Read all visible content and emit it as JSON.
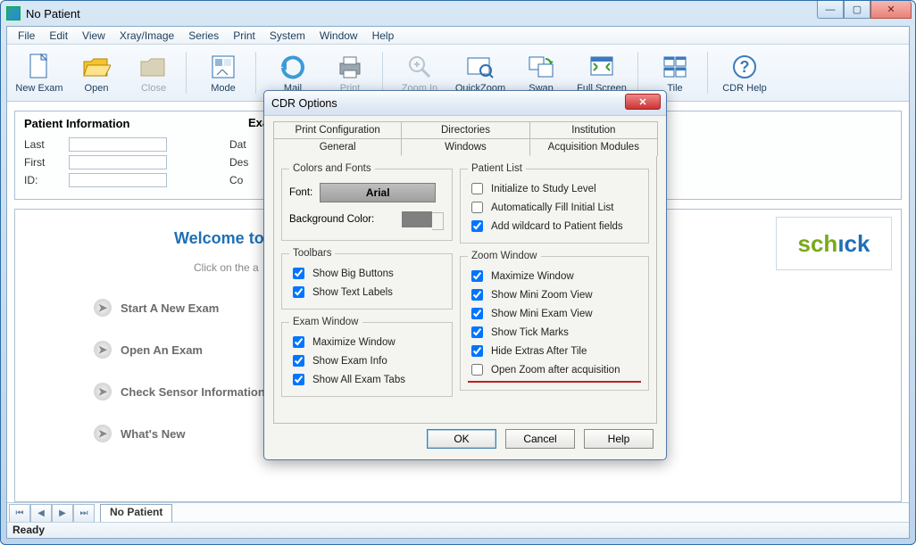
{
  "window": {
    "title": "No Patient"
  },
  "menu": [
    "File",
    "Edit",
    "View",
    "Xray/Image",
    "Series",
    "Print",
    "System",
    "Window",
    "Help"
  ],
  "toolbar": [
    {
      "label": "New Exam",
      "disabled": false,
      "icon": "new"
    },
    {
      "label": "Open",
      "disabled": false,
      "icon": "open"
    },
    {
      "label": "Close",
      "disabled": true,
      "icon": "close"
    },
    {
      "sep": true
    },
    {
      "label": "Mode",
      "disabled": false,
      "icon": "mode"
    },
    {
      "sep": true
    },
    {
      "label": "Mail",
      "disabled": false,
      "icon": "mail"
    },
    {
      "label": "Print",
      "disabled": true,
      "icon": "print"
    },
    {
      "sep": true
    },
    {
      "label": "Zoom In",
      "disabled": true,
      "icon": "zoomin"
    },
    {
      "label": "QuickZoom",
      "disabled": false,
      "icon": "quickzoom"
    },
    {
      "label": "Swap",
      "disabled": false,
      "icon": "swap"
    },
    {
      "label": "Full Screen",
      "disabled": false,
      "icon": "fullscreen"
    },
    {
      "sep": true
    },
    {
      "label": "Tile",
      "disabled": false,
      "icon": "tile"
    },
    {
      "sep": true
    },
    {
      "label": "CDR Help",
      "disabled": false,
      "icon": "help"
    }
  ],
  "patient_panel": {
    "heading": "Patient Information",
    "heading2": "Exa",
    "rows": [
      {
        "label": "Last",
        "label2": "Dat"
      },
      {
        "label": "First",
        "label2": "Des"
      },
      {
        "label": "ID:",
        "label2": "Co"
      }
    ]
  },
  "welcome": {
    "title": "Welcome to",
    "sub": "Click on the a",
    "items": [
      "Start A New Exam",
      "Open An Exam",
      "Check Sensor Information",
      "What's New"
    ],
    "logo": {
      "part1": "sch",
      "part2": "ıck"
    }
  },
  "tab": "No Patient",
  "status": "Ready",
  "dialog": {
    "title": "CDR Options",
    "tabs_row1": [
      "Print Configuration",
      "Directories",
      "Institution"
    ],
    "tabs_row2": [
      "General",
      "Windows",
      "Acquisition Modules"
    ],
    "active_tab": "Windows",
    "colors_fonts": {
      "legend": "Colors and Fonts",
      "font_label": "Font:",
      "font_value": "Arial",
      "bg_label": "Background Color:"
    },
    "toolbars": {
      "legend": "Toolbars",
      "items": [
        {
          "label": "Show Big Buttons",
          "checked": true
        },
        {
          "label": "Show Text Labels",
          "checked": true
        }
      ]
    },
    "exam_window": {
      "legend": "Exam Window",
      "items": [
        {
          "label": "Maximize Window",
          "checked": true
        },
        {
          "label": "Show Exam Info",
          "checked": true
        },
        {
          "label": "Show All Exam Tabs",
          "checked": true
        }
      ]
    },
    "patient_list": {
      "legend": "Patient List",
      "items": [
        {
          "label": "Initialize to Study Level",
          "checked": false
        },
        {
          "label": "Automatically Fill Initial List",
          "checked": false
        },
        {
          "label": "Add wildcard to Patient fields",
          "checked": true
        }
      ]
    },
    "zoom_window": {
      "legend": "Zoom Window",
      "items": [
        {
          "label": "Maximize Window",
          "checked": true
        },
        {
          "label": "Show Mini Zoom View",
          "checked": true
        },
        {
          "label": "Show Mini Exam View",
          "checked": true
        },
        {
          "label": "Show Tick Marks",
          "checked": true
        },
        {
          "label": "Hide Extras After Tile",
          "checked": true
        },
        {
          "label": "Open Zoom after acquisition",
          "checked": false,
          "highlight": true
        }
      ]
    },
    "buttons": {
      "ok": "OK",
      "cancel": "Cancel",
      "help": "Help"
    }
  }
}
